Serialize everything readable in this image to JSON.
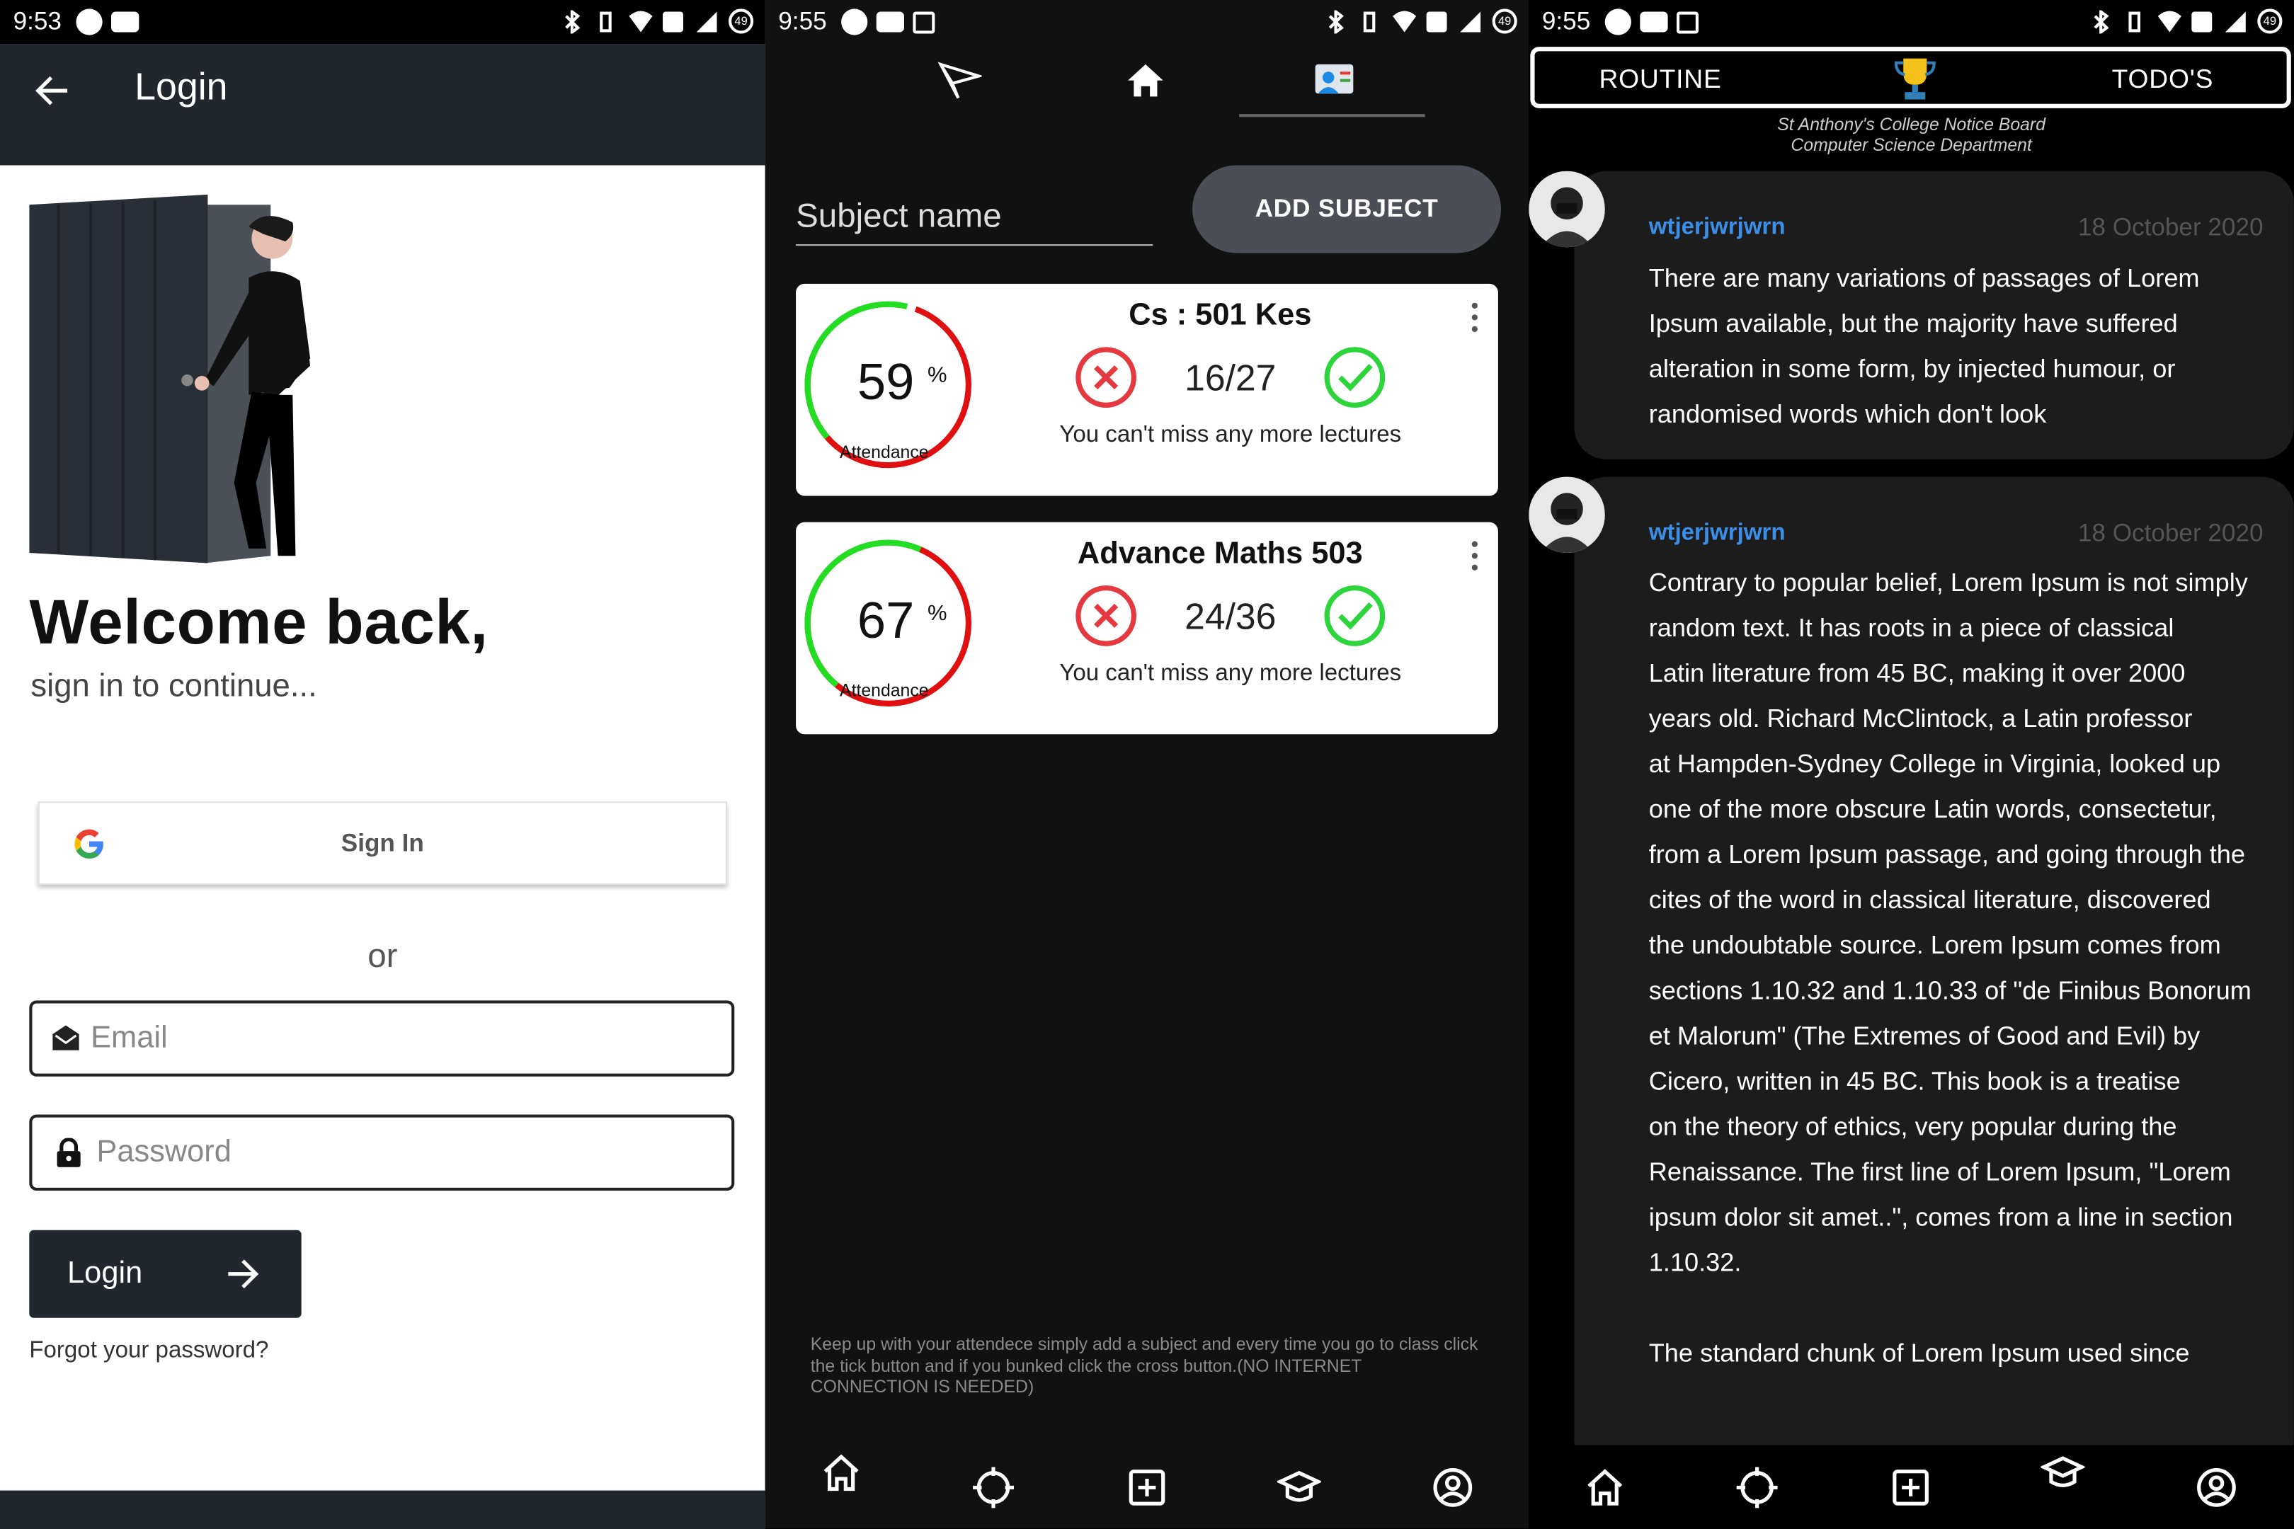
{
  "status": {
    "p1_time": "9:53",
    "p2_time": "9:55",
    "p3_time": "9:55",
    "battery": "49"
  },
  "login": {
    "title": "Login",
    "welcome": "Welcome back,",
    "subtitle": "sign in to continue...",
    "google_button": "Sign In",
    "or": "or",
    "email_placeholder": "Email",
    "password_placeholder": "Password",
    "login_button": "Login",
    "forgot": "Forgot your password?"
  },
  "attendance": {
    "subject_placeholder": "Subject name",
    "add_button": "ADD SUBJECT",
    "subjects": [
      {
        "name": "Cs : 501 Kes",
        "percent": "59",
        "percent_sign": "%",
        "label": "Attendance",
        "count": "16/27",
        "message": "You can't miss any more lectures",
        "fraction": 0.59
      },
      {
        "name": "Advance Maths 503",
        "percent": "67",
        "percent_sign": "%",
        "label": "Attendance",
        "count": "24/36",
        "message": "You can't miss any more lectures",
        "fraction": 0.67
      }
    ],
    "note": "Keep up with your attendece simply add a subject and every time you go to class click the tick button and if you bunked click the cross button.(NO INTERNET CONNECTION IS NEEDED)"
  },
  "notice": {
    "tab_left": "ROUTINE",
    "tab_right": "TODO'S",
    "board_title": "St Anthony's College Notice Board",
    "board_dept": "Computer Science Department",
    "posts": [
      {
        "user": "wtjerjwrjwrn",
        "date": "18 October 2020",
        "body": "There are many variations of passages of Lorem\nIpsum available, but the majority have suffered\nalteration in some form, by injected humour, or\nrandomised words which don't look"
      },
      {
        "user": "wtjerjwrjwrn",
        "date": "18 October 2020",
        "body": "Contrary to popular belief, Lorem Ipsum is not simply\nrandom text. It has roots in a piece of classical\nLatin literature from 45 BC, making it over 2000\nyears old. Richard McClintock, a Latin professor\nat Hampden-Sydney College in Virginia, looked up\none of the more obscure Latin words, consectetur,\nfrom a Lorem Ipsum passage, and going through the\ncites of the word in classical literature, discovered\nthe undoubtable source. Lorem Ipsum comes from\nsections 1.10.32 and 1.10.33 of \"de Finibus Bonorum\net Malorum\" (The Extremes of Good and Evil) by\nCicero, written in 45 BC. This book is a treatise\non the theory of ethics, very popular during the\nRenaissance. The first line of Lorem Ipsum, \"Lorem\nipsum dolor sit amet..\", comes from a line in section\n1.10.32.\n\nThe standard chunk of Lorem Ipsum used since"
      }
    ]
  },
  "colors": {
    "dark": "#22262d",
    "link": "#3b8fe8",
    "gauge_green": "#22dd22",
    "gauge_red": "#e01010"
  }
}
